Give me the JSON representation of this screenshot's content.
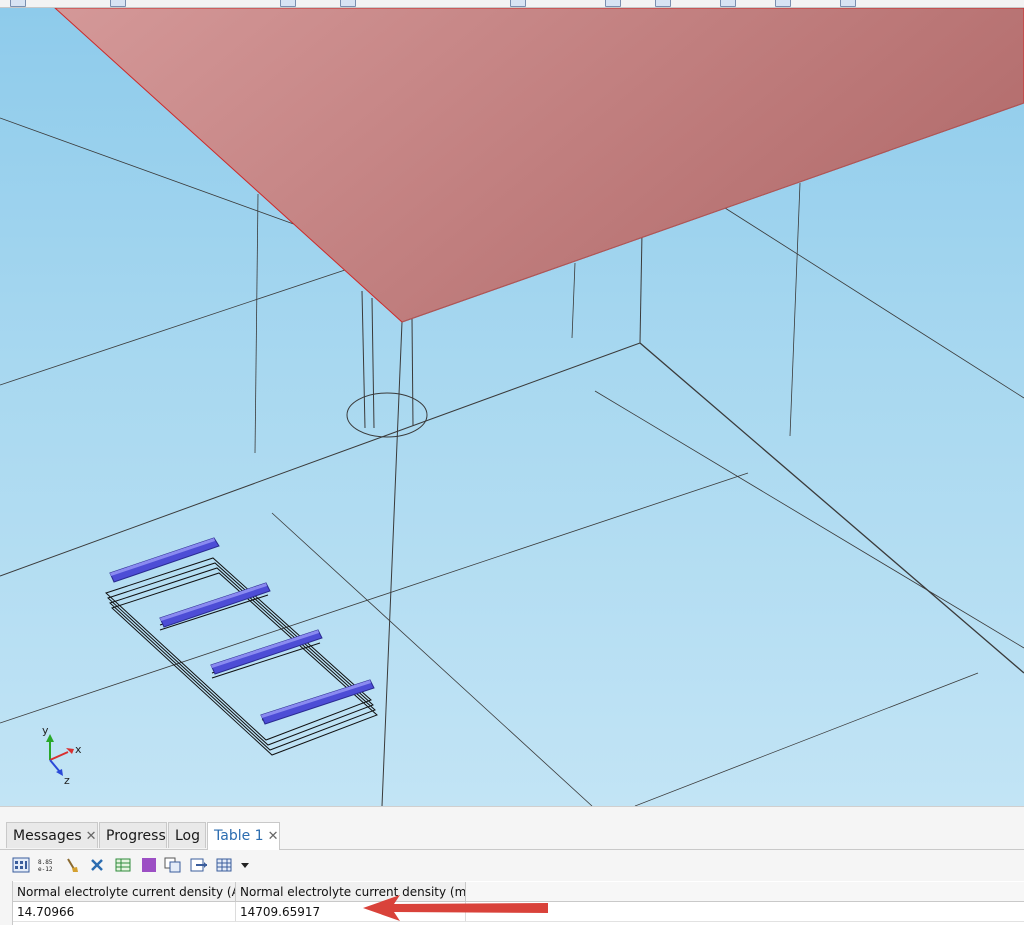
{
  "window": {
    "title": ""
  },
  "graphics": {
    "axes": {
      "x": "x",
      "y": "y",
      "z": "z"
    }
  },
  "tabs": [
    {
      "label": "Messages",
      "closable": true,
      "active": false
    },
    {
      "label": "Progress",
      "closable": false,
      "active": false
    },
    {
      "label": "Log",
      "closable": false,
      "active": false
    },
    {
      "label": "Table 1",
      "closable": true,
      "active": true
    }
  ],
  "table_toolbar": {
    "icons": [
      "table-view-icon",
      "number-format-icon",
      "clear-icon",
      "delete-icon",
      "spreadsheet-icon",
      "color-fill-icon",
      "copy-table-icon",
      "export-icon",
      "table-settings-icon",
      "dropdown-arrow-icon"
    ],
    "number_format_text": "8.85\ne-12"
  },
  "table": {
    "columns": [
      "Normal electrolyte current density (A)",
      "Normal electrolyte current density (mA)"
    ],
    "rows": [
      [
        "14.70966",
        "14709.65917"
      ]
    ]
  },
  "colors": {
    "arrow": "#d9423a",
    "surface": "#c98585",
    "electrode": "#4a4ad0",
    "active_tab_text": "#2b6cb0"
  }
}
